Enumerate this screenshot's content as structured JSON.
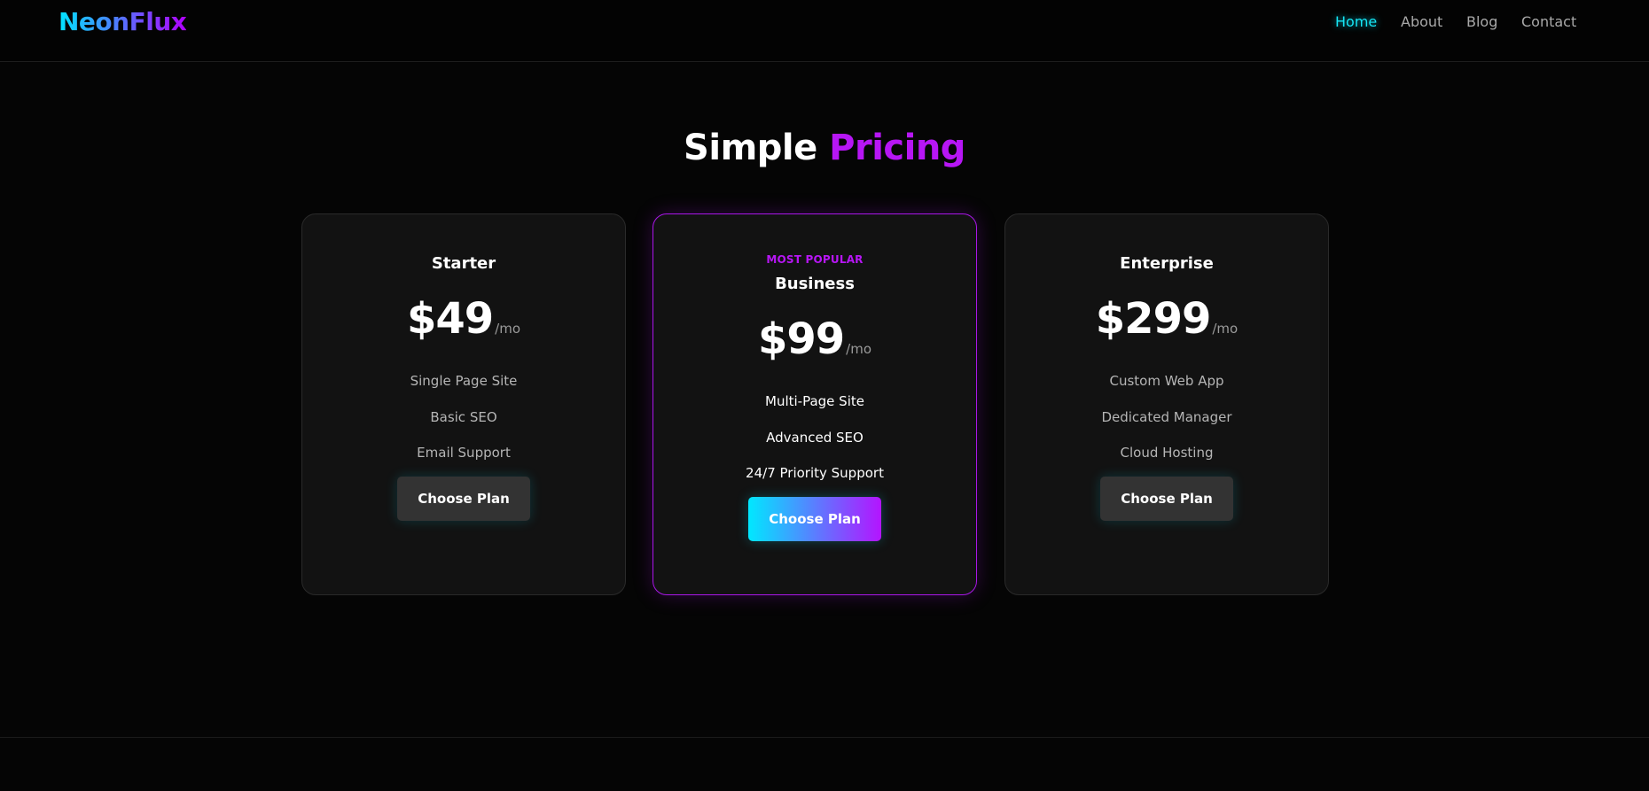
{
  "brand": {
    "logo": "NeonFlux"
  },
  "nav": {
    "items": [
      {
        "label": "Home",
        "active": true
      },
      {
        "label": "About",
        "active": false
      },
      {
        "label": "Blog",
        "active": false
      },
      {
        "label": "Contact",
        "active": false
      }
    ]
  },
  "pricing": {
    "title_plain": "Simple",
    "title_accent": "Pricing",
    "plans": [
      {
        "name": "Starter",
        "price": "$49",
        "period": "/mo",
        "features": [
          "Single Page Site",
          "Basic SEO",
          "Email Support"
        ],
        "cta": "Choose Plan"
      },
      {
        "badge": "MOST POPULAR",
        "name": "Business",
        "price": "$99",
        "period": "/mo",
        "features": [
          "Multi-Page Site",
          "Advanced SEO",
          "24/7 Priority Support"
        ],
        "cta": "Choose Plan"
      },
      {
        "name": "Enterprise",
        "price": "$299",
        "period": "/mo",
        "features": [
          "Custom Web App",
          "Dedicated Manager",
          "Cloud Hosting"
        ],
        "cta": "Choose Plan"
      }
    ]
  },
  "colors": {
    "background": "#050505",
    "accent_cyan": "#00e5ff",
    "accent_purple": "#b716f5",
    "card": "#121212"
  }
}
